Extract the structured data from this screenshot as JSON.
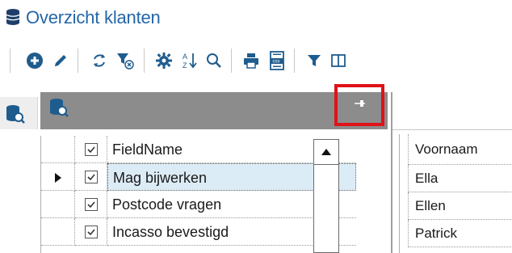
{
  "title": "Overzicht klanten",
  "toolbar": {
    "icons": [
      "add-icon",
      "edit-icon",
      "refresh-icon",
      "clear-filter-icon",
      "settings-icon",
      "sort-icon",
      "search-icon",
      "print-icon",
      "export-csv-icon",
      "filter-icon",
      "columns-icon"
    ],
    "csv_label": "csv"
  },
  "field_panel": {
    "header_label": "FieldName",
    "rows": [
      {
        "name": "Mag bijwerken",
        "checked": true,
        "current": true
      },
      {
        "name": "Postcode vragen",
        "checked": true,
        "current": false
      },
      {
        "name": "Incasso bevestigd",
        "checked": true,
        "current": false
      }
    ],
    "header_checked": true
  },
  "right_grid": {
    "header": "Voornaam",
    "rows": [
      "Ella",
      "Ellen",
      "Patrick"
    ]
  },
  "colors": {
    "title": "#2466a8",
    "accent_icon": "#1f5c8e",
    "panel_header": "#8c8c8c",
    "highlight_border": "#e0121a",
    "selected_row": "#dcecf7"
  }
}
